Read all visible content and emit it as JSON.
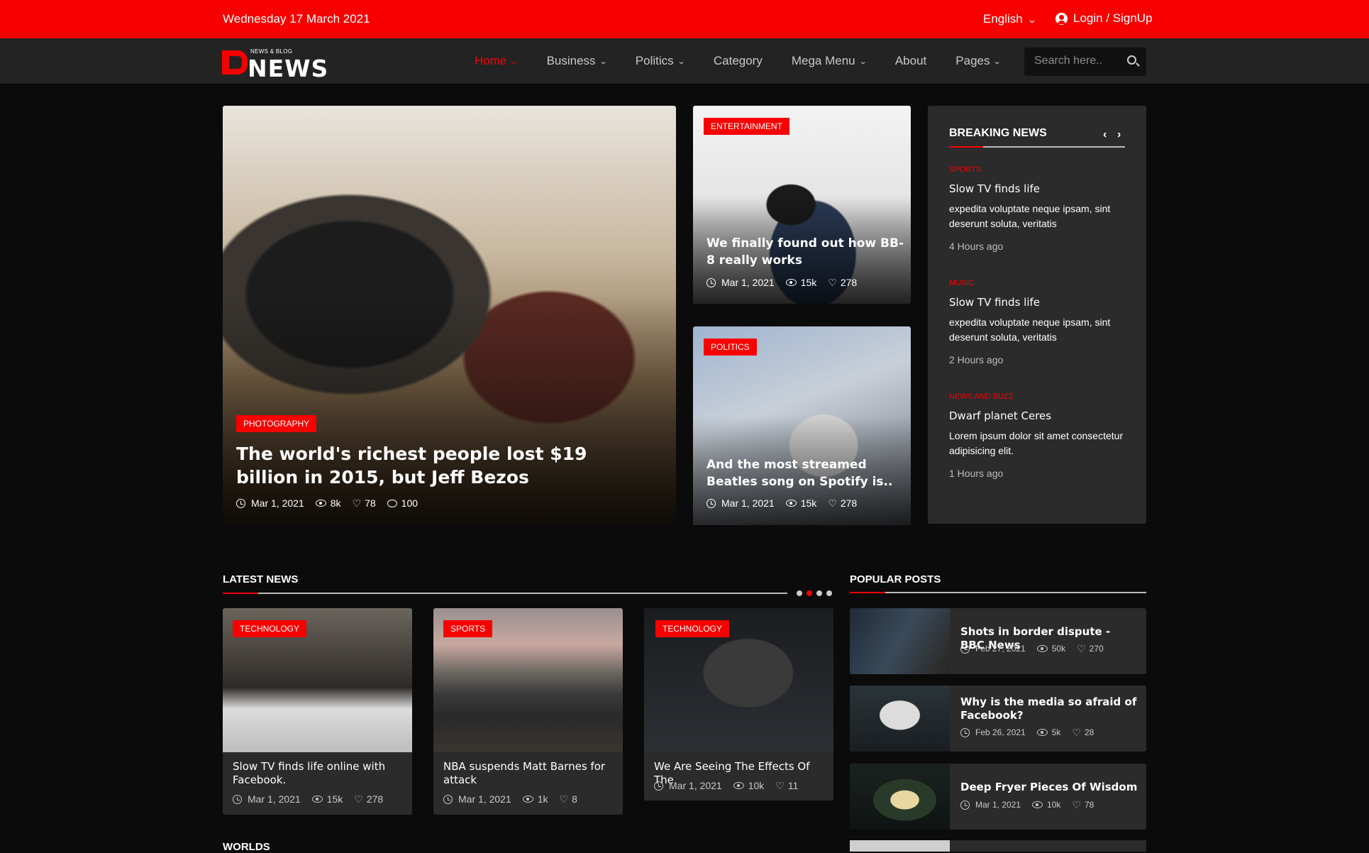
{
  "topbar": {
    "date": "Wednesday 17 March 2021",
    "language": "English",
    "login": "Login / SignUp"
  },
  "logo": {
    "tagline": "NEWS & BLOG",
    "word": "NEWS",
    "letter": "D"
  },
  "nav": {
    "items": [
      "Home",
      "Business",
      "Politics",
      "Category",
      "Mega Menu",
      "About",
      "Pages"
    ],
    "active": "Home"
  },
  "search": {
    "placeholder": "Search here.."
  },
  "hero": {
    "main": {
      "badge": "PHOTOGRAPHY",
      "title": "The world's richest people lost $19 billion in 2015, but Jeff Bezos",
      "date": "Mar 1, 2021",
      "views": "8k",
      "likes": "78",
      "comments": "100"
    },
    "side1": {
      "badge": "ENTERTAINMENT",
      "title": "We finally found out how BB-8 really works",
      "date": "Mar 1, 2021",
      "views": "15k",
      "likes": "278"
    },
    "side2": {
      "badge": "POLITICS",
      "title": "And the most streamed Beatles song on Spotify is..",
      "date": "Mar 1, 2021",
      "views": "15k",
      "likes": "278"
    }
  },
  "breaking": {
    "heading": "BREAKING NEWS",
    "items": [
      {
        "category": "SPORTS",
        "title": "Slow TV finds life",
        "desc": "expedita voluptate neque ipsam, sint deserunt soluta, veritatis",
        "ago": "4 Hours ago"
      },
      {
        "category": "MUSIC",
        "title": "Slow TV finds life",
        "desc": "expedita voluptate neque ipsam, sint deserunt soluta, veritatis",
        "ago": "2 Hours ago"
      },
      {
        "category": "NEWS AND BUZZ",
        "title": "Dwarf planet Ceres",
        "desc": "Lorem ipsum dolor sit amet consectetur adipisicing elit.",
        "ago": "1 Hours ago"
      }
    ]
  },
  "latest": {
    "heading": "LATEST NEWS",
    "cards": [
      {
        "badge": "TECHNOLOGY",
        "title": "Slow TV finds life online with Facebook.",
        "date": "Mar 1, 2021",
        "views": "15k",
        "likes": "278"
      },
      {
        "badge": "SPORTS",
        "title": "NBA suspends Matt Barnes for attack",
        "date": "Mar 1, 2021",
        "views": "1k",
        "likes": "8"
      },
      {
        "badge": "TECHNOLOGY",
        "title": "We Are Seeing The Effects Of The",
        "date": "Mar 1, 2021",
        "views": "10k",
        "likes": "11"
      }
    ]
  },
  "popular": {
    "heading": "POPULAR POSTS",
    "items": [
      {
        "title": "Shots in border dispute - BBC News",
        "date": "Feb 27, 2021",
        "views": "50k",
        "likes": "270"
      },
      {
        "title": "Why is the media so afraid of Facebook?",
        "date": "Feb 26, 2021",
        "views": "5k",
        "likes": "28"
      },
      {
        "title": "Deep Fryer Pieces Of Wisdom",
        "date": "Mar 1, 2021",
        "views": "10k",
        "likes": "78"
      }
    ]
  },
  "worlds": {
    "heading": "WORLDS"
  },
  "colors": {
    "accent": "#f70000",
    "panel": "#2b2b2b",
    "nav": "#232323",
    "background": "#0b0b0b"
  }
}
